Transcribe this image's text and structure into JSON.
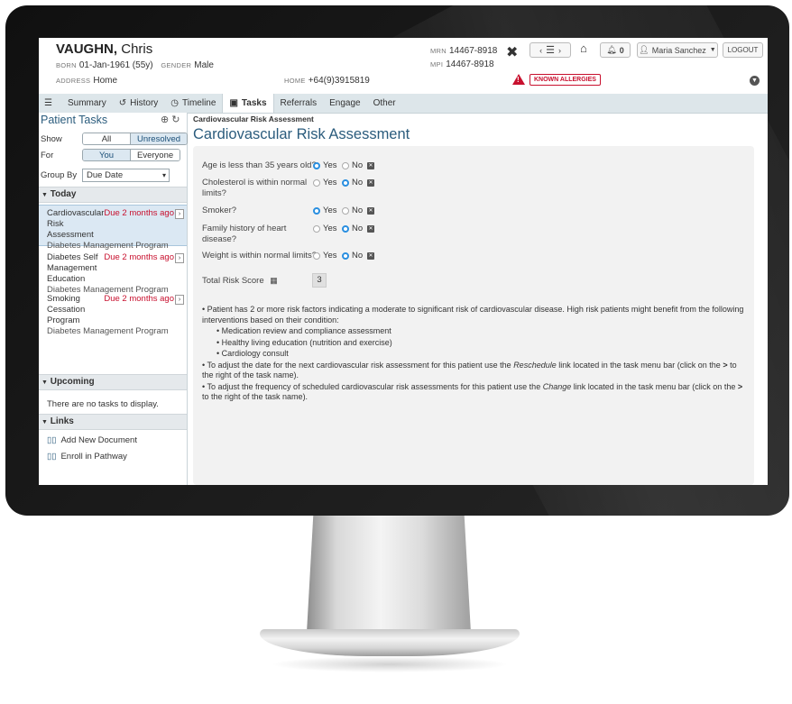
{
  "patient": {
    "last_name": "VAUGHN,",
    "first_name": "Chris",
    "born_label": "BORN",
    "born": "01-Jan-1961 (55y)",
    "gender_label": "GENDER",
    "gender": "Male",
    "address_label": "ADDRESS",
    "address": "Home",
    "home_label": "HOME",
    "home_phone": "+64(9)3915819",
    "mrn_label": "MRN",
    "mrn": "14467-8918",
    "mpi_label": "MPI",
    "mpi": "14467-8918",
    "allergy_badge": "KNOWN ALLERGIES"
  },
  "toolbar": {
    "notifications": "0",
    "user": "Maria Sanchez",
    "logout": "LOGOUT"
  },
  "tabs": [
    {
      "label": "Summary"
    },
    {
      "label": "History"
    },
    {
      "label": "Timeline"
    },
    {
      "label": "Tasks"
    },
    {
      "label": "Referrals"
    },
    {
      "label": "Engage"
    },
    {
      "label": "Other"
    }
  ],
  "left": {
    "title": "Patient Tasks",
    "show_label": "Show",
    "show_options": [
      "All",
      "Unresolved"
    ],
    "for_label": "For",
    "for_options": [
      "You",
      "Everyone"
    ],
    "group_label": "Group By",
    "group_value": "Due Date",
    "sections": {
      "today": "Today",
      "upcoming": "Upcoming",
      "links": "Links"
    },
    "tasks": [
      {
        "name": "Cardiovascular Risk Assessment",
        "due": "Due 2 months ago",
        "program": "Diabetes Management Program"
      },
      {
        "name": "Diabetes Self Management Education",
        "due": "Due 2 months ago",
        "program": "Diabetes Management Program"
      },
      {
        "name": "Smoking Cessation Program",
        "due": "Due 2 months ago",
        "program": "Diabetes Management Program"
      }
    ],
    "no_tasks": "There are no tasks to display.",
    "links": [
      "Add New Document",
      "Enroll in Pathway"
    ]
  },
  "main": {
    "breadcrumb": "Cardiovascular Risk Assessment",
    "title": "Cardiovascular Risk Assessment",
    "yes": "Yes",
    "no": "No",
    "questions": [
      {
        "text": "Age is less than 35 years old?",
        "answer": "Yes"
      },
      {
        "text": "Cholesterol is within normal limits?",
        "answer": "No"
      },
      {
        "text": "Smoker?",
        "answer": "Yes"
      },
      {
        "text": "Family history of heart disease?",
        "answer": "No"
      },
      {
        "text": "Weight is within normal limits?",
        "answer": "No"
      }
    ],
    "score_label": "Total Risk Score",
    "score": "3",
    "note1": "Patient has 2 or more risk factors indicating a moderate to significant risk of cardiovascular disease. High risk patients might benefit from the following interventions based on their condition:",
    "interventions": [
      "Medication review and compliance assessment",
      "Healthy living education (nutrition and exercise)",
      "Cardiology consult"
    ],
    "note2_a": "To adjust the date for the next cardiovascular risk assessment for this patient use the ",
    "note2_em": "Reschedule",
    "note2_b": " link located in the task menu bar (click on the ",
    "note2_gt": ">",
    "note2_c": " to the right of the task name).",
    "note3_a": "To adjust the frequency of scheduled cardiovascular risk assessments for this patient use the ",
    "note3_em": "Change",
    "note3_b": " link located in the task menu bar (click on the ",
    "note3_gt": ">",
    "note3_c": " to the right of the task name)."
  }
}
